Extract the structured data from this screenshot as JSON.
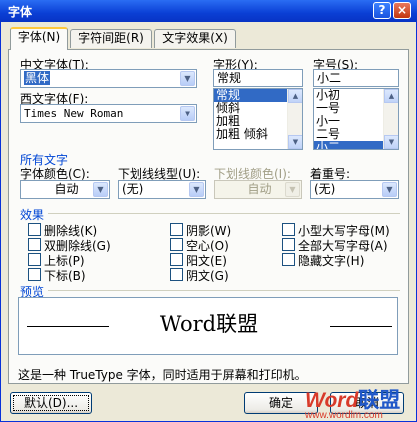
{
  "window": {
    "title": "字体",
    "help_label": "?",
    "close_label": "×"
  },
  "tabs": [
    {
      "label": "字体(N)",
      "active": true
    },
    {
      "label": "字符间距(R)",
      "active": false
    },
    {
      "label": "文字效果(X)",
      "active": false
    }
  ],
  "font": {
    "cn_font_label": "中文字体(T):",
    "cn_font_value": "黑体",
    "west_font_label": "西文字体(F):",
    "west_font_value": "Times New Roman",
    "style_label": "字形(Y):",
    "style_value": "常规",
    "style_options": [
      "常规",
      "倾斜",
      "加粗",
      "加粗 倾斜"
    ],
    "size_label": "字号(S):",
    "size_value": "小二",
    "size_options": [
      "小初",
      "一号",
      "小一",
      "二号",
      "小二"
    ]
  },
  "all_text": {
    "section_label": "所有文字",
    "color_label": "字体颜色(C):",
    "color_value": "自动",
    "underline_label": "下划线线型(U):",
    "underline_value": "(无)",
    "underline_color_label": "下划线颜色(I):",
    "underline_color_value": "自动",
    "emphasis_label": "着重号:",
    "emphasis_value": "(无)"
  },
  "effects": {
    "section_label": "效果",
    "col1": [
      "删除线(K)",
      "双删除线(G)",
      "上标(P)",
      "下标(B)"
    ],
    "col2": [
      "阴影(W)",
      "空心(O)",
      "阳文(E)",
      "阴文(G)"
    ],
    "col3": [
      "小型大写字母(M)",
      "全部大写字母(A)",
      "隐藏文字(H)"
    ]
  },
  "preview": {
    "section_label": "预览",
    "sample_text": "Word联盟"
  },
  "info_text": "这是一种 TrueType 字体，同时适用于屏幕和打印机。",
  "buttons": {
    "default_label": "默认(D)...",
    "ok_label": "确定",
    "cancel_label": "取消"
  },
  "watermark": {
    "word": "Word",
    "brand": "联盟",
    "url": "www.wordlm.com"
  },
  "colors": {
    "title_bar": "#0a3fd5",
    "accent_blue": "#0046d5",
    "selection": "#316ac5"
  }
}
